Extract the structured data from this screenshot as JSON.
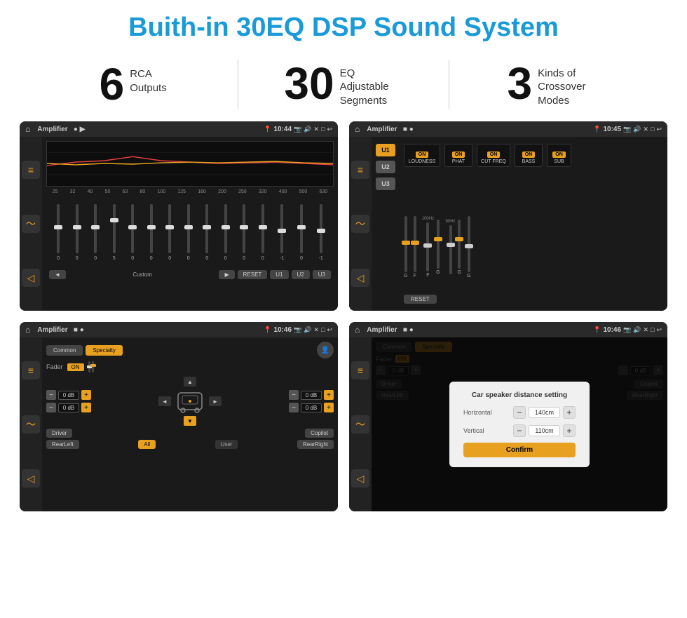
{
  "header": {
    "title": "Buith-in 30EQ DSP Sound System"
  },
  "stats": [
    {
      "number": "6",
      "label": "RCA\nOutputs"
    },
    {
      "number": "30",
      "label": "EQ Adjustable\nSegments"
    },
    {
      "number": "3",
      "label": "Kinds of\nCrossover Modes"
    }
  ],
  "screens": [
    {
      "id": "eq-screen",
      "status_bar": {
        "home": "⌂",
        "title": "Amplifier",
        "icons": "● ▶",
        "location": "📍",
        "time": "10:44",
        "extra_icons": "📷 🔊 ✕ □ ↩"
      },
      "freq_labels": [
        "25",
        "32",
        "40",
        "50",
        "63",
        "80",
        "100",
        "125",
        "160",
        "200",
        "250",
        "320",
        "400",
        "500",
        "630"
      ],
      "slider_values": [
        "0",
        "0",
        "0",
        "5",
        "0",
        "0",
        "0",
        "0",
        "0",
        "0",
        "0",
        "0",
        "-1",
        "0",
        "-1"
      ],
      "controls": [
        "◄",
        "Custom",
        "▶",
        "RESET",
        "U1",
        "U2",
        "U3"
      ]
    },
    {
      "id": "crossover-screen",
      "status_bar": {
        "title": "Amplifier",
        "time": "10:45"
      },
      "u_buttons": [
        "U1",
        "U2",
        "U3"
      ],
      "modules": [
        "LOUDNESS",
        "PHAT",
        "CUT FREQ",
        "BASS",
        "SUB"
      ],
      "reset_label": "RESET"
    },
    {
      "id": "fader-screen",
      "status_bar": {
        "title": "Amplifier",
        "time": "10:46"
      },
      "tabs": [
        "Common",
        "Specialty"
      ],
      "fader_label": "Fader",
      "fader_on": "ON",
      "vol_labels": [
        "0 dB",
        "0 dB",
        "0 dB",
        "0 dB"
      ],
      "bottom_buttons": [
        "Driver",
        "",
        "Copilot",
        "RearLeft",
        "All",
        "User",
        "RearRight"
      ]
    },
    {
      "id": "dialog-screen",
      "status_bar": {
        "title": "Amplifier",
        "time": "10:46"
      },
      "tabs": [
        "Common",
        "Specialty"
      ],
      "dialog": {
        "title": "Car speaker distance setting",
        "horizontal_label": "Horizontal",
        "horizontal_value": "140cm",
        "vertical_label": "Vertical",
        "vertical_value": "110cm",
        "confirm_label": "Confirm"
      }
    }
  ],
  "colors": {
    "accent": "#e8a020",
    "title_blue": "#1a9ad7",
    "bg_dark": "#1a1a1a",
    "text_light": "#cccccc"
  }
}
